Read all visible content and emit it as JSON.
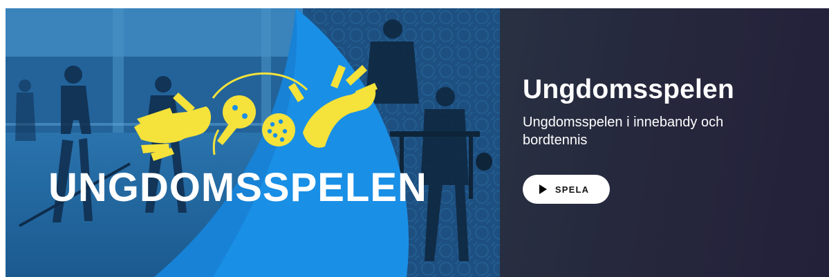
{
  "banner": {
    "logo_text": "UNGDOMSSPELEN",
    "title": "Ungdomsspelen",
    "subtitle": "Ungdomsspelen i innebandy och bordtennis",
    "play_label": "SPELA",
    "play_icon": "play-icon"
  },
  "colors": {
    "logo_yellow": "#f5e23a",
    "accent_blue": "#1a8fe6",
    "photo_tint": "#1b4f7e",
    "panel_dark": "#26283d"
  }
}
